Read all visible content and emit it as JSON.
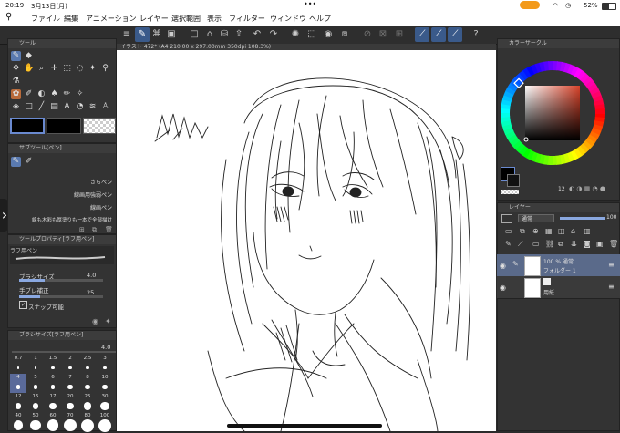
{
  "status": {
    "time": "20:19",
    "date": "3月13日(月)",
    "battery": "52%",
    "dots": "•••"
  },
  "menu": {
    "items": [
      "ファイル",
      "編集",
      "アニメーション",
      "レイヤー",
      "選択範囲",
      "表示",
      "フィルター",
      "ウィンドウ",
      "ヘルプ"
    ]
  },
  "document": {
    "tab_label": "イラスト 472* (A4 210.00 x 297.00mm 350dpi 108.3%)"
  },
  "panels": {
    "tool": {
      "title": "ツール"
    },
    "subtool": {
      "title": "サブツール[ペン]",
      "items": [
        "さらペン",
        "線画用強弱ペン",
        "線画ペン",
        "線も木彩も厚塗りも一本で全部描け"
      ]
    },
    "tool_property": {
      "title": "ツールプロパティ[ラフ用ペン]",
      "tab_label": "ラフ用ペン",
      "brush_size_label": "ブラシサイズ",
      "brush_size_value": "4.0",
      "stabilization_label": "手ブレ補正",
      "stabilization_value": "25",
      "snap_label": "スナップ可能"
    },
    "brush_size": {
      "title": "ブラシサイズ[ラフ用ペン]",
      "current": "4.0",
      "sizes": [
        "0.7",
        "1",
        "1.5",
        "2",
        "2.5",
        "3",
        "4",
        "5",
        "6",
        "7",
        "8",
        "10",
        "12",
        "15",
        "17",
        "20",
        "25",
        "30",
        "40",
        "50",
        "60",
        "70",
        "80",
        "100"
      ]
    },
    "color": {
      "title": "カラーサークル",
      "value_label": "12",
      "colors": {
        "main": "#000000",
        "sub": "#1a1a1a"
      }
    },
    "layer": {
      "title": "レイヤー",
      "blend_mode": "通常",
      "opacity": "100",
      "layers": [
        {
          "name_line1": "100 % 通常",
          "name_line2": "フォルダー 1"
        },
        {
          "name_line1": "用紙",
          "name_line2": ""
        }
      ]
    }
  }
}
